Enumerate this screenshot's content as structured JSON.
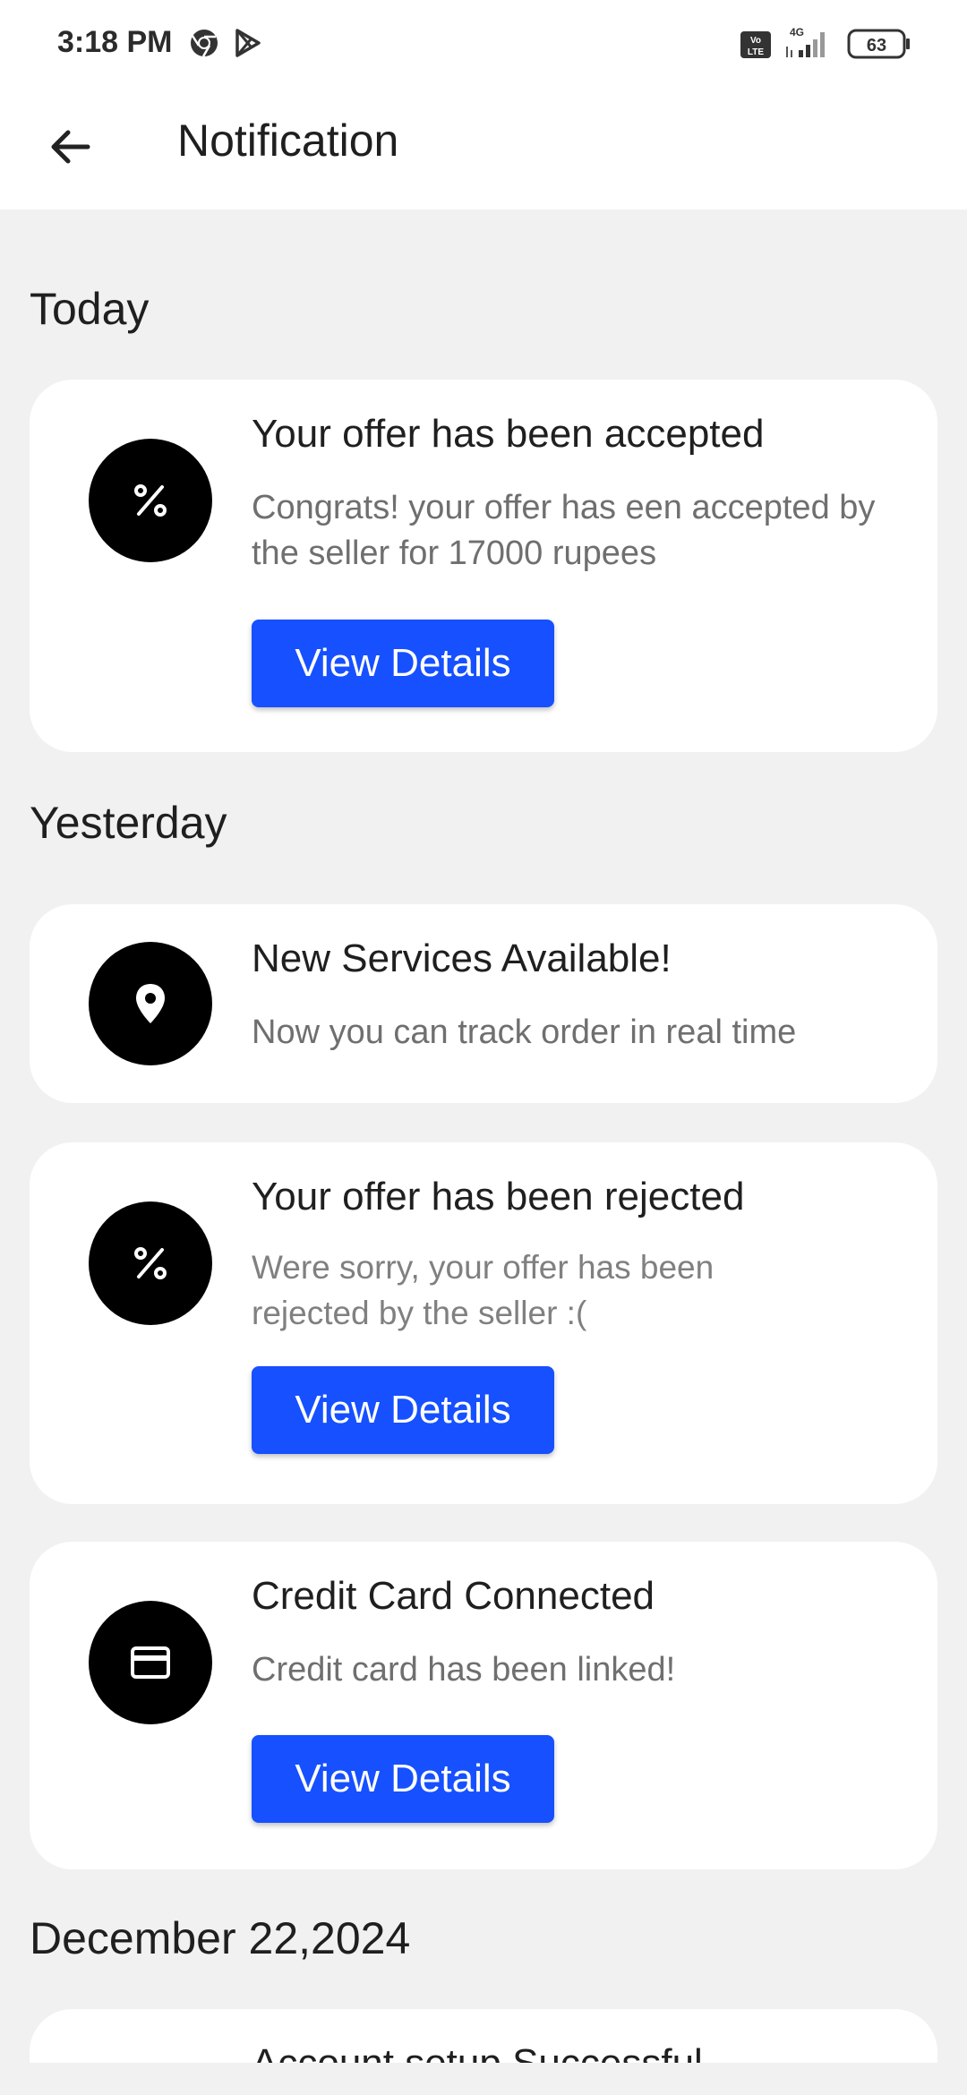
{
  "status_bar": {
    "time": "3:18 PM",
    "battery": "63",
    "network": "4G",
    "volte": "Vo LTE"
  },
  "app_bar": {
    "title": "Notification"
  },
  "sections": [
    {
      "title": "Today",
      "items": [
        {
          "icon": "percent-icon",
          "title": "Your offer has been accepted",
          "text": "Congrats! your offer has een accepted by the seller for 17000 rupees",
          "button": "View Details"
        }
      ]
    },
    {
      "title": "Yesterday",
      "items": [
        {
          "icon": "location-pin-icon",
          "title": "New Services Available!",
          "text": "Now you can track order in real time"
        },
        {
          "icon": "percent-icon",
          "title": "Your offer has been rejected",
          "text": "Were sorry, your offer has been rejected by the seller :(",
          "button": "View Details"
        },
        {
          "icon": "credit-card-icon",
          "title": "Credit Card Connected",
          "text": "Credit card has been linked!",
          "button": "View Details"
        }
      ]
    },
    {
      "title": "December 22,2024",
      "items": [
        {
          "title": "Account setup Successful"
        }
      ]
    }
  ],
  "colors": {
    "accent": "#1650ff",
    "background": "#f1f1f1",
    "card": "#ffffff",
    "icon_circle": "#000000"
  }
}
